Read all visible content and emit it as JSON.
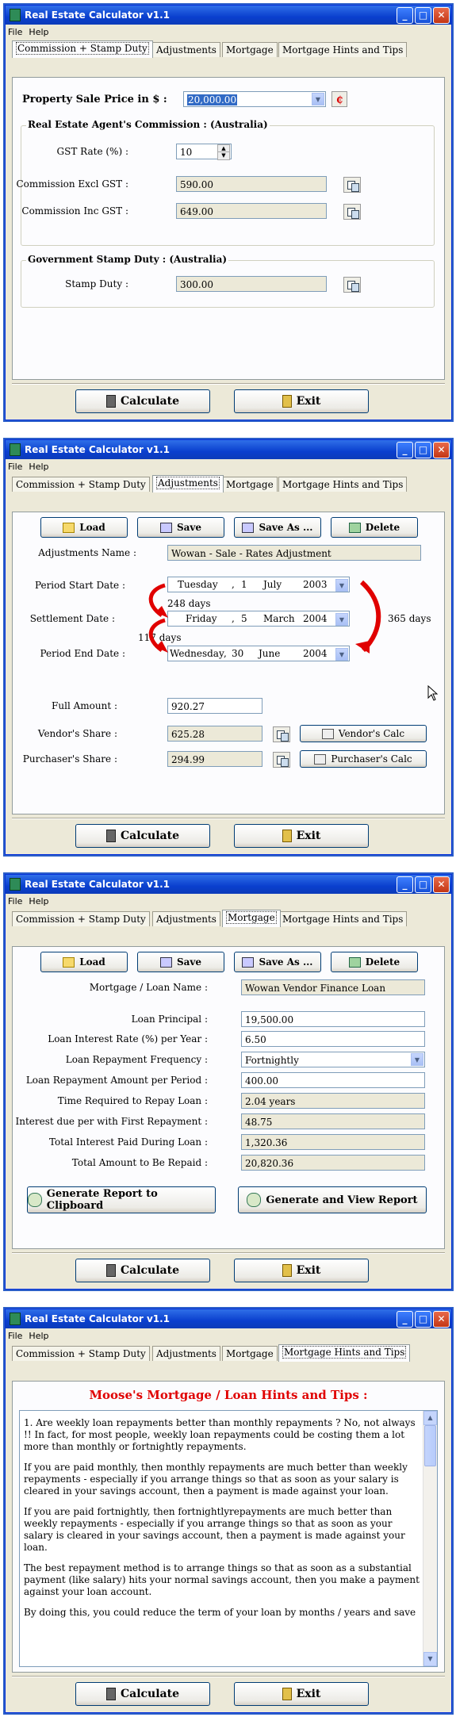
{
  "app": {
    "title": "Real Estate Calculator v1.1",
    "menu": [
      "File",
      "Help"
    ]
  },
  "tabs": [
    "Commission + Stamp Duty",
    "Adjustments",
    "Mortgage",
    "Mortgage Hints and Tips"
  ],
  "bottom": {
    "calculate": "Calculate",
    "exit": "Exit"
  },
  "commission": {
    "sale_label": "Property Sale Price in $ :",
    "sale_value": "20,000.00",
    "agent_group": "Real Estate Agent's Commission :  (Australia)",
    "gst_label": "GST Rate (%) :",
    "gst_value": "10",
    "excl_label": "Commission Excl GST :",
    "excl_value": "590.00",
    "inc_label": "Commission Inc GST :",
    "inc_value": "649.00",
    "stamp_group": "Government Stamp Duty :  (Australia)",
    "stamp_label": "Stamp Duty :",
    "stamp_value": "300.00"
  },
  "toolbar": {
    "load": "Load",
    "save": "Save",
    "save_as": "Save As ...",
    "delete": "Delete"
  },
  "adjustments": {
    "name_label": "Adjustments Name :",
    "name_value": "Wowan - Sale - Rates Adjustment",
    "start_label": "Period Start Date :",
    "start": {
      "day": "Tuesday",
      "d": "1",
      "month": "July",
      "year": "2003"
    },
    "days1": "248 days",
    "settle_label": "Settlement Date :",
    "settle": {
      "day": "Friday",
      "d": "5",
      "month": "March",
      "year": "2004"
    },
    "days2": "117 days",
    "end_label": "Period End Date :",
    "end": {
      "day": "Wednesday",
      "d": "30",
      "month": "June",
      "year": "2004"
    },
    "total_days": "365 days",
    "full_label": "Full Amount :",
    "full_value": "920.27",
    "vendor_label": "Vendor's Share :",
    "vendor_value": "625.28",
    "vendor_calc": "Vendor's Calc",
    "purch_label": "Purchaser's Share :",
    "purch_value": "294.99",
    "purch_calc": "Purchaser's Calc"
  },
  "mortgage": {
    "name_label": "Mortgage / Loan Name :",
    "name_value": "Wowan Vendor Finance Loan",
    "principal_label": "Loan Principal :",
    "principal_value": "19,500.00",
    "rate_label": "Loan Interest Rate (%) per Year :",
    "rate_value": "6.50",
    "freq_label": "Loan Repayment Frequency :",
    "freq_value": "Fortnightly",
    "amount_label": "Loan Repayment Amount per Period :",
    "amount_value": "400.00",
    "time_label": "Time Required to Repay Loan :",
    "time_value": "2.04 years",
    "interest_first_label": "Interest due per with First Repayment :",
    "interest_first_value": "48.75",
    "total_interest_label": "Total Interest Paid During Loan :",
    "total_interest_value": "1,320.36",
    "total_label": "Total Amount to Be Repaid :",
    "total_value": "20,820.36",
    "report_clip": "Generate Report to Clipboard",
    "report_view": "Generate and View Report"
  },
  "hints": {
    "heading": "Moose's Mortgage / Loan Hints and Tips :",
    "paragraphs": [
      "1.  Are weekly loan repayments better than monthly repayments ?  No, not always !!  In fact, for most people, weekly loan repayments could be costing them a lot more than monthly or fortnightly repayments.",
      "If you are paid monthly, then monthly repayments are much better than weekly repayments - especially if you arrange things so that as soon as your salary is cleared in your savings account, then a payment is made against your loan.",
      "If you are paid fortnightly, then fortnightlyrepayments are much better than weekly repayments - especially if you arrange things so that as soon as your salary is cleared in your savings account, then a payment is made against your loan.",
      "The best repayment method is to arrange things so that as soon as a substantial payment (like salary) hits your normal savings account, then you make a payment against your loan account.",
      "By doing this, you could reduce the term of your loan by months / years and save"
    ]
  }
}
